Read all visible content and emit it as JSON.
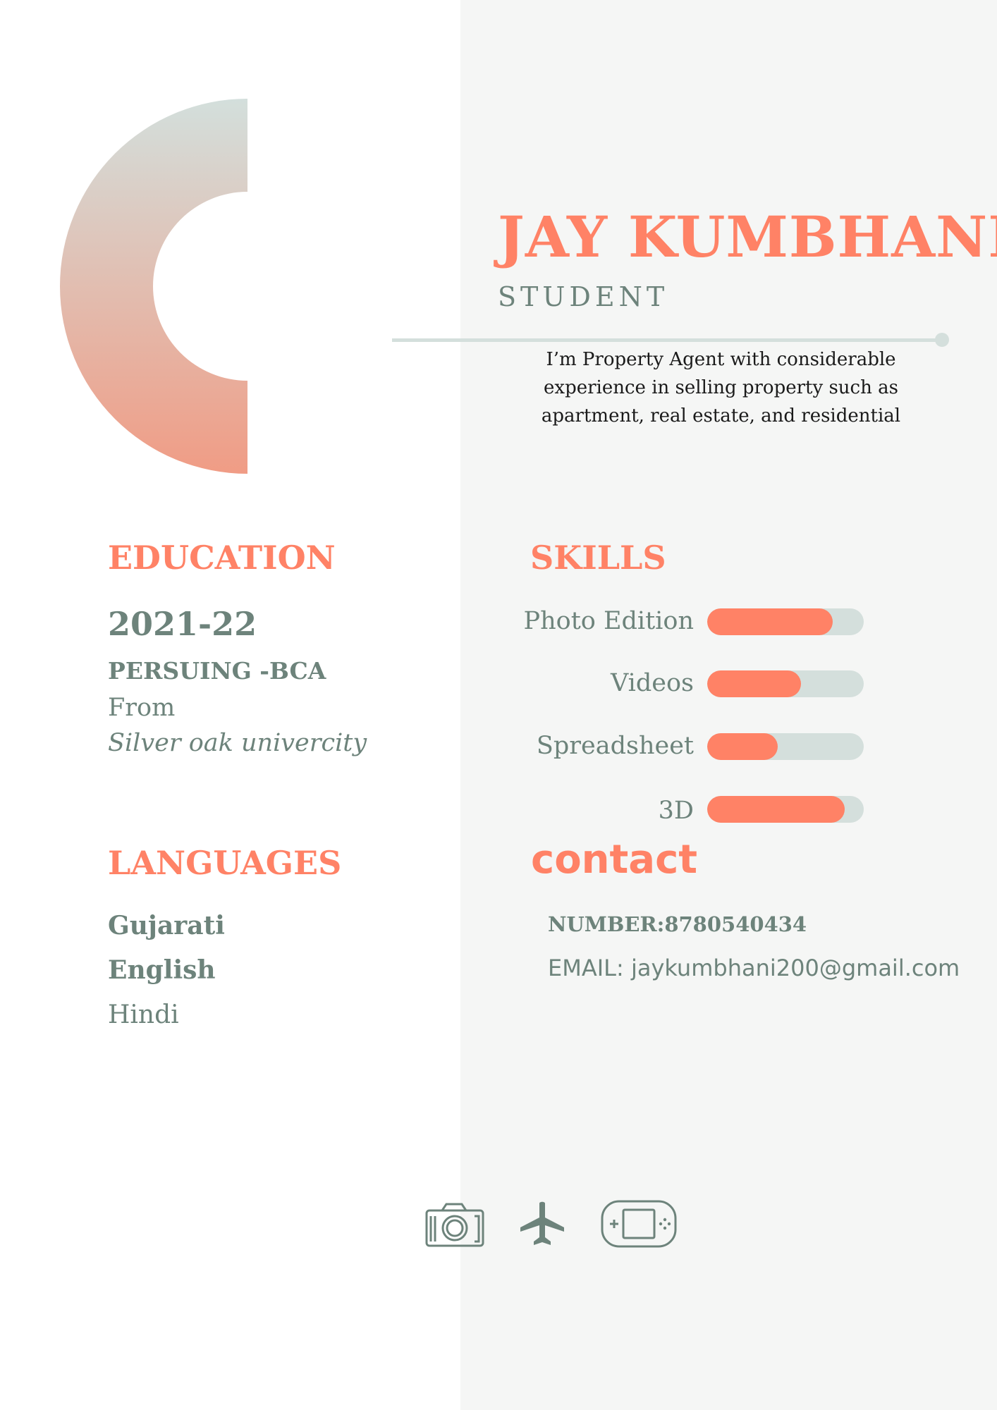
{
  "header": {
    "name": "JAY KUMBHANI",
    "role": "STUDENT",
    "summary": "I’m Property Agent with considerable experience in selling property such as apartment, real estate, and residential"
  },
  "education": {
    "heading": "EDUCATION",
    "year": "2021-22",
    "degree": "PERSUING -BCA",
    "from_label": "From",
    "school": "Silver oak univercity"
  },
  "languages": {
    "heading": "LANGUAGES",
    "items": [
      "Gujarati",
      "English",
      "Hindi"
    ]
  },
  "skills": {
    "heading": "SKILLS",
    "items": [
      {
        "label": "Photo Edition",
        "level": 0.8
      },
      {
        "label": "Videos",
        "level": 0.6
      },
      {
        "label": "Spreadsheet",
        "level": 0.45
      },
      {
        "label": "3D",
        "level": 0.88
      }
    ]
  },
  "contact": {
    "heading": "contact",
    "number": "NUMBER:8780540434",
    "email": "EMAIL: jaykumbhani200@gmail.com"
  },
  "hobbies": {
    "icons": [
      "camera-icon",
      "airplane-icon",
      "game-console-icon"
    ]
  },
  "colors": {
    "accent": "#ff8266",
    "muted": "#6d837b",
    "track": "#d4dfdc",
    "panel": "#f5f6f5"
  }
}
